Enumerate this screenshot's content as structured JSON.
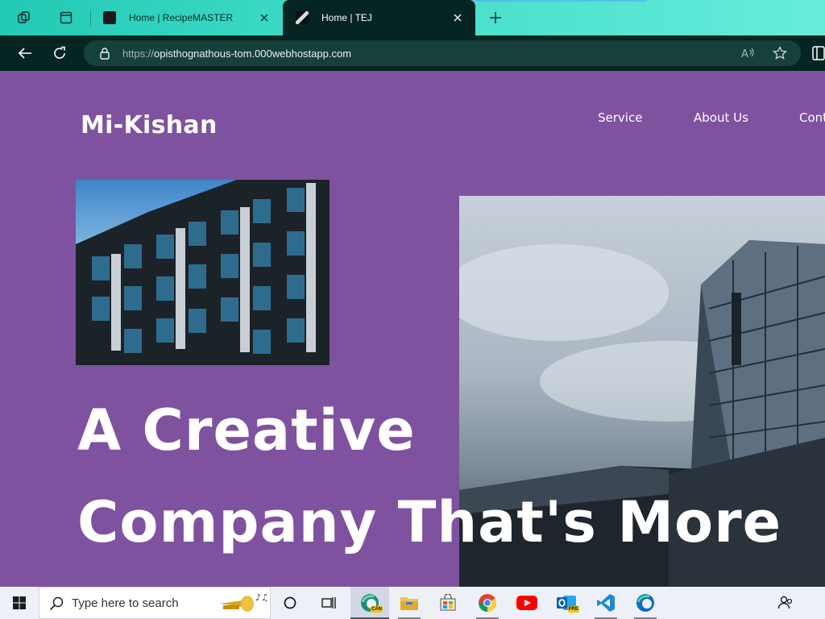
{
  "browser": {
    "tabs": [
      {
        "title": "Home | RecipeMASTER",
        "active": false
      },
      {
        "title": "Home | TEJ",
        "active": true
      }
    ],
    "address": {
      "scheme": "https://",
      "host": "opisthognathous-tom.000webhostapp.com"
    }
  },
  "site": {
    "brand": "Mi-Kishan",
    "nav": [
      "Service",
      "About Us",
      "Cont"
    ],
    "headline_line1": "A Creative",
    "headline_line2": "Company That's More"
  },
  "taskbar": {
    "search_placeholder": "Type here to search",
    "apps": [
      "edge-canary",
      "file-explorer",
      "microsoft-store",
      "chrome",
      "youtube",
      "outlook",
      "vs-code",
      "edge"
    ],
    "edge_canary_badge": "CAN",
    "outlook_badge": "PRE"
  },
  "colors": {
    "page_background": "#7f52a0",
    "tabstrip": "#3fdcc8",
    "toolbar": "#052522"
  }
}
